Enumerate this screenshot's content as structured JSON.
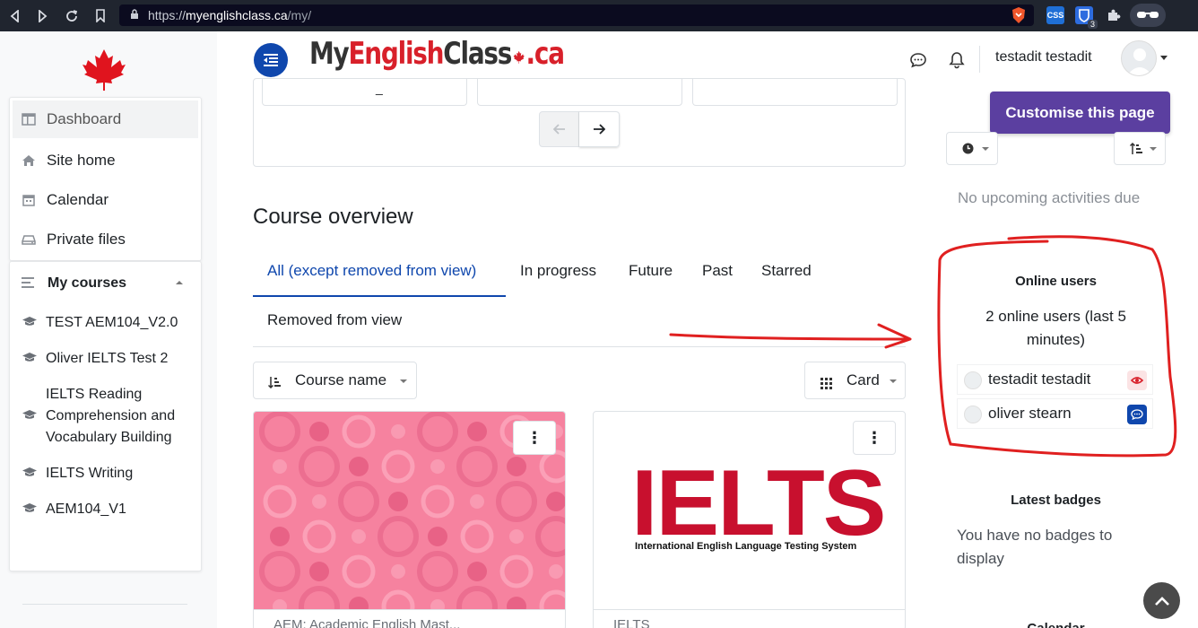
{
  "browser": {
    "url_scheme": "https://",
    "url_host": "myenglishclass.ca",
    "url_path": "/my/",
    "ext_count": "3"
  },
  "header": {
    "logo_my": "My",
    "logo_english": "English",
    "logo_class": "Class",
    "logo_ca": ".ca",
    "user_name": "testadit testadit"
  },
  "nav": {
    "items": [
      {
        "label": "Dashboard",
        "icon": "dashboard-icon"
      },
      {
        "label": "Site home",
        "icon": "home-icon"
      },
      {
        "label": "Calendar",
        "icon": "calendar-icon"
      },
      {
        "label": "Private files",
        "icon": "drive-icon"
      }
    ],
    "my_courses": "My courses",
    "courses": [
      "TEST AEM104_V2.0",
      "Oliver IELTS Test 2",
      "IELTS Reading Comprehension and Vocabulary Building",
      "IELTS Writing",
      "AEM104_V1"
    ]
  },
  "main": {
    "recent_mark": "_",
    "overview_title": "Course overview",
    "tabs": [
      "All (except removed from view)",
      "In progress",
      "Future",
      "Past",
      "Starred",
      "Removed from view"
    ],
    "sort_label": "Course name",
    "view_label": "Card",
    "card_menu": "⋮",
    "ielts_big": "IELTS",
    "ielts_sub": "International English Language Testing System",
    "card1_footer": "AEM: Academic English Mast...",
    "card2_footer": "IELTS"
  },
  "right": {
    "customise": "Customise this page",
    "no_upcoming": "No upcoming activities due",
    "online_title": "Online users",
    "online_count": "2 online users (last 5 minutes)",
    "online_users": [
      "testadit testadit",
      "oliver stearn"
    ],
    "badges_title": "Latest badges",
    "badges_text": "You have no badges to display",
    "next_title": "Calendar"
  },
  "colors": {
    "primary": "#0f47ad",
    "customise": "#5b3fa0",
    "brand_red": "#d8202a",
    "annotation": "#e02020"
  }
}
